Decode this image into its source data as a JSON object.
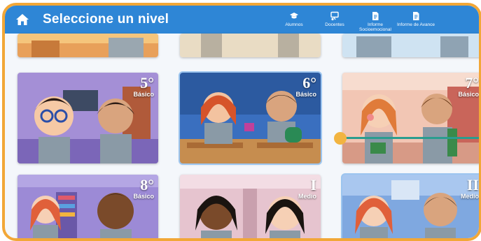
{
  "header": {
    "title": "Seleccione un nivel",
    "nav": [
      {
        "label": "Alumnos",
        "icon": "graduation-cap-icon"
      },
      {
        "label": "Docentes",
        "icon": "presentation-board-icon"
      },
      {
        "label": "Informe Socioemocional",
        "icon": "document-icon"
      },
      {
        "label": "Informe de Avance",
        "icon": "document-icon"
      }
    ]
  },
  "levels": [
    {
      "number": "5°",
      "sub": "Básico",
      "scene": "purple-classroom"
    },
    {
      "number": "6°",
      "sub": "Básico",
      "scene": "blue-classroom"
    },
    {
      "number": "7°",
      "sub": "Básico",
      "scene": "hallway-lockers"
    },
    {
      "number": "8°",
      "sub": "Básico",
      "scene": "library"
    },
    {
      "number": "I",
      "sub": "Medio",
      "scene": "school-corridor"
    },
    {
      "number": "II",
      "sub": "Medio",
      "scene": "gym"
    }
  ],
  "colors": {
    "header": "#2e86d6",
    "frame": "#f2a737",
    "slider_track": "#2a9d8f",
    "slider_knob": "#f2b440"
  }
}
